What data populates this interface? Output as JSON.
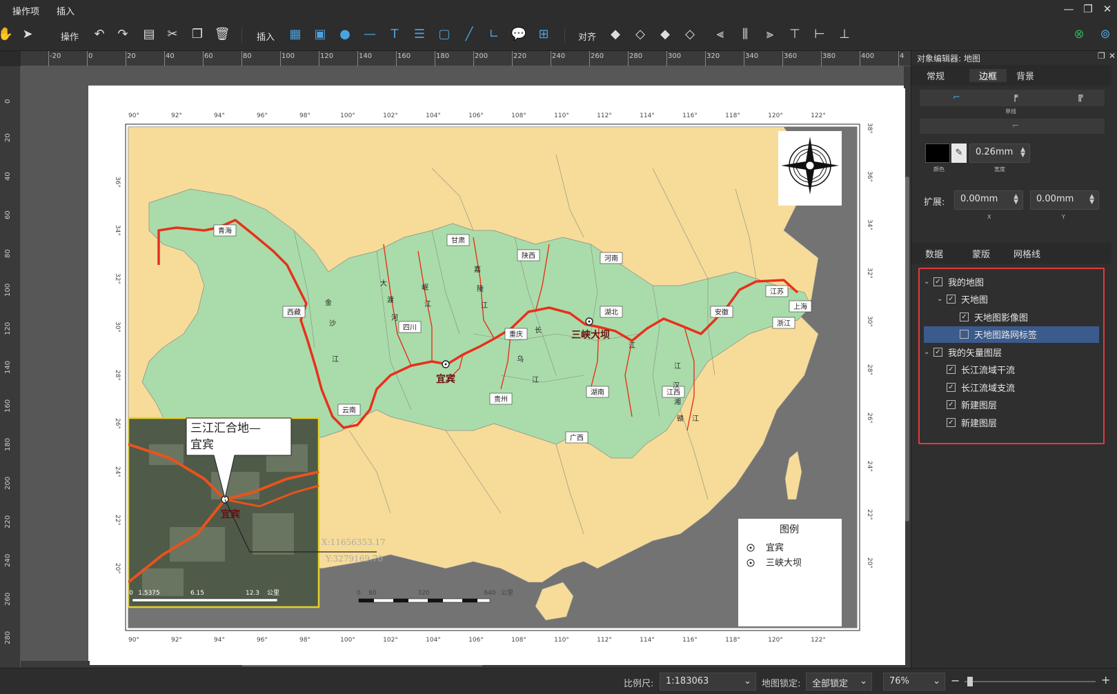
{
  "menu": {
    "ops": "操作项",
    "insert": "插入"
  },
  "toolbar": {
    "ops_label": "操作",
    "insert_label": "插入",
    "align_label": "对齐"
  },
  "ruler": {
    "h_ticks": [
      "-20",
      "0",
      "20",
      "40",
      "60",
      "80",
      "100",
      "120",
      "140",
      "160",
      "180",
      "200",
      "220",
      "240",
      "260",
      "280",
      "300",
      "320",
      "340",
      "360",
      "380",
      "400",
      "4"
    ],
    "v_ticks": [
      "0",
      "20",
      "40",
      "60",
      "80",
      "100",
      "120",
      "140",
      "160",
      "180",
      "200",
      "220",
      "240",
      "260",
      "280"
    ]
  },
  "map": {
    "top_lon": [
      "90°",
      "92°",
      "94°",
      "96°",
      "98°",
      "100°",
      "102°",
      "104°",
      "106°",
      "108°",
      "110°",
      "112°",
      "114°",
      "116°",
      "118°",
      "120°",
      "122°"
    ],
    "bottom_lon": [
      "90°",
      "92°",
      "94°",
      "96°",
      "98°",
      "100°",
      "102°",
      "104°",
      "106°",
      "108°",
      "110°",
      "112°",
      "114°",
      "116°",
      "118°",
      "120°",
      "122°"
    ],
    "left_lat": [
      "36°",
      "34°",
      "32°",
      "30°",
      "28°",
      "26°",
      "24°",
      "22°",
      "20°"
    ],
    "right_lat": [
      "38°",
      "36°",
      "34°",
      "32°",
      "30°",
      "28°",
      "26°",
      "24°",
      "22°",
      "20°"
    ],
    "provinces": [
      "青海",
      "甘肃",
      "陕西",
      "河南",
      "西藏",
      "四川",
      "重庆",
      "湖北",
      "安徽",
      "江苏",
      "上海",
      "浙江",
      "云南",
      "贵州",
      "湖南",
      "江西",
      "广西"
    ],
    "river_chars": [
      "金",
      "沙",
      "江",
      "大",
      "渡",
      "河",
      "岷",
      "江",
      "嘉",
      "陵",
      "江",
      "乌",
      "江",
      "长",
      "江",
      "汉",
      "湘",
      "江",
      "赣",
      "江"
    ],
    "points": {
      "yibin": "宜宾",
      "sanxia": "三峡大坝"
    },
    "inset_title": "三江汇合地—宜宾",
    "inset_label": "宜宾",
    "inset_scale": [
      "0",
      "1.5375",
      "6.15",
      "12.3",
      "公里"
    ],
    "coord_x": "X:11656353.17",
    "coord_y": "Y:3279169.70",
    "scale": [
      "0",
      "80",
      "320",
      "640",
      "公里"
    ],
    "legend": {
      "title": "图例",
      "items": [
        "宜宾",
        "三峡大坝"
      ]
    }
  },
  "panel": {
    "title": "对象编辑器: 地图",
    "tabs": [
      "常规",
      "边框",
      "背景"
    ],
    "line_label": "单线",
    "color_label": "颜色",
    "width_value": "0.26mm",
    "width_label": "宽度",
    "expand_label": "扩展:",
    "expand_x": "0.00mm",
    "expand_y": "0.00mm",
    "x_label": "X",
    "y_label": "Y",
    "subtabs": [
      "数据",
      "蒙版",
      "网格线"
    ],
    "tree": [
      {
        "label": "我的地图",
        "level": 0,
        "checked": true,
        "expanded": true
      },
      {
        "label": "天地图",
        "level": 1,
        "checked": true,
        "expanded": true
      },
      {
        "label": "天地图影像图",
        "level": 2,
        "checked": true
      },
      {
        "label": "天地图路网标签",
        "level": 2,
        "checked": false,
        "selected": true
      },
      {
        "label": "我的矢量图层",
        "level": 0,
        "checked": true,
        "expanded": true
      },
      {
        "label": "长江流域干流",
        "level": 1,
        "checked": true
      },
      {
        "label": "长江流域支流",
        "level": 1,
        "checked": true
      },
      {
        "label": "新建图层",
        "level": 1,
        "checked": true
      },
      {
        "label": "新建图层",
        "level": 1,
        "checked": true
      }
    ]
  },
  "status": {
    "scale_label": "比例尺:",
    "scale_value": "1:183063",
    "lock_label": "地图锁定:",
    "lock_value": "全部锁定",
    "zoom": "76%"
  },
  "colors": {
    "basin": "#a9dcaa",
    "land": "#f6dc98",
    "sea": "#737373",
    "river": "#e8301c",
    "accent": "#e23b3b"
  }
}
